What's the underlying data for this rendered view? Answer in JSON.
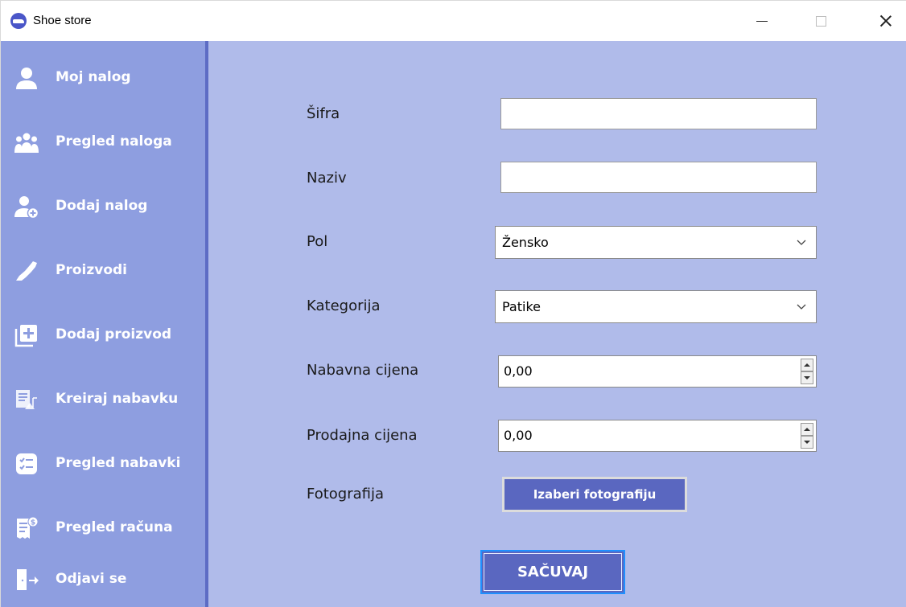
{
  "window": {
    "title": "Shoe store",
    "controls": [
      "minimize",
      "maximize",
      "close"
    ]
  },
  "sidebar": {
    "items": [
      {
        "label": "Moj nalog",
        "icon": "user-icon"
      },
      {
        "label": "Pregled naloga",
        "icon": "users-group-icon"
      },
      {
        "label": "Dodaj nalog",
        "icon": "add-user-icon"
      },
      {
        "label": "Proizvodi",
        "icon": "shoe-icon"
      },
      {
        "label": "Dodaj proizvod",
        "icon": "add-box-icon"
      },
      {
        "label": "Kreiraj nabavku",
        "icon": "create-order-icon"
      },
      {
        "label": "Pregled nabavki",
        "icon": "checklist-icon"
      },
      {
        "label": "Pregled računa",
        "icon": "bill-icon"
      },
      {
        "label": "Odjavi se",
        "icon": "logout-icon"
      }
    ]
  },
  "form": {
    "sifra_label": "Šifra",
    "sifra_value": "",
    "naziv_label": "Naziv",
    "naziv_value": "",
    "pol_label": "Pol",
    "pol_value": "Žensko",
    "kategorija_label": "Kategorija",
    "kategorija_value": "Patike",
    "nabavna_label": "Nabavna cijena",
    "nabavna_value": "0,00",
    "prodajna_label": "Prodajna cijena",
    "prodajna_value": "0,00",
    "fotografija_label": "Fotografija",
    "photo_button": "Izaberi fotografiju",
    "save_button": "SAČUVAJ"
  },
  "colors": {
    "sidebar_bg": "#8e9ee0",
    "content_bg": "#b0bbea",
    "button_bg": "#5a67c0",
    "focus_border": "#1e90ff"
  }
}
